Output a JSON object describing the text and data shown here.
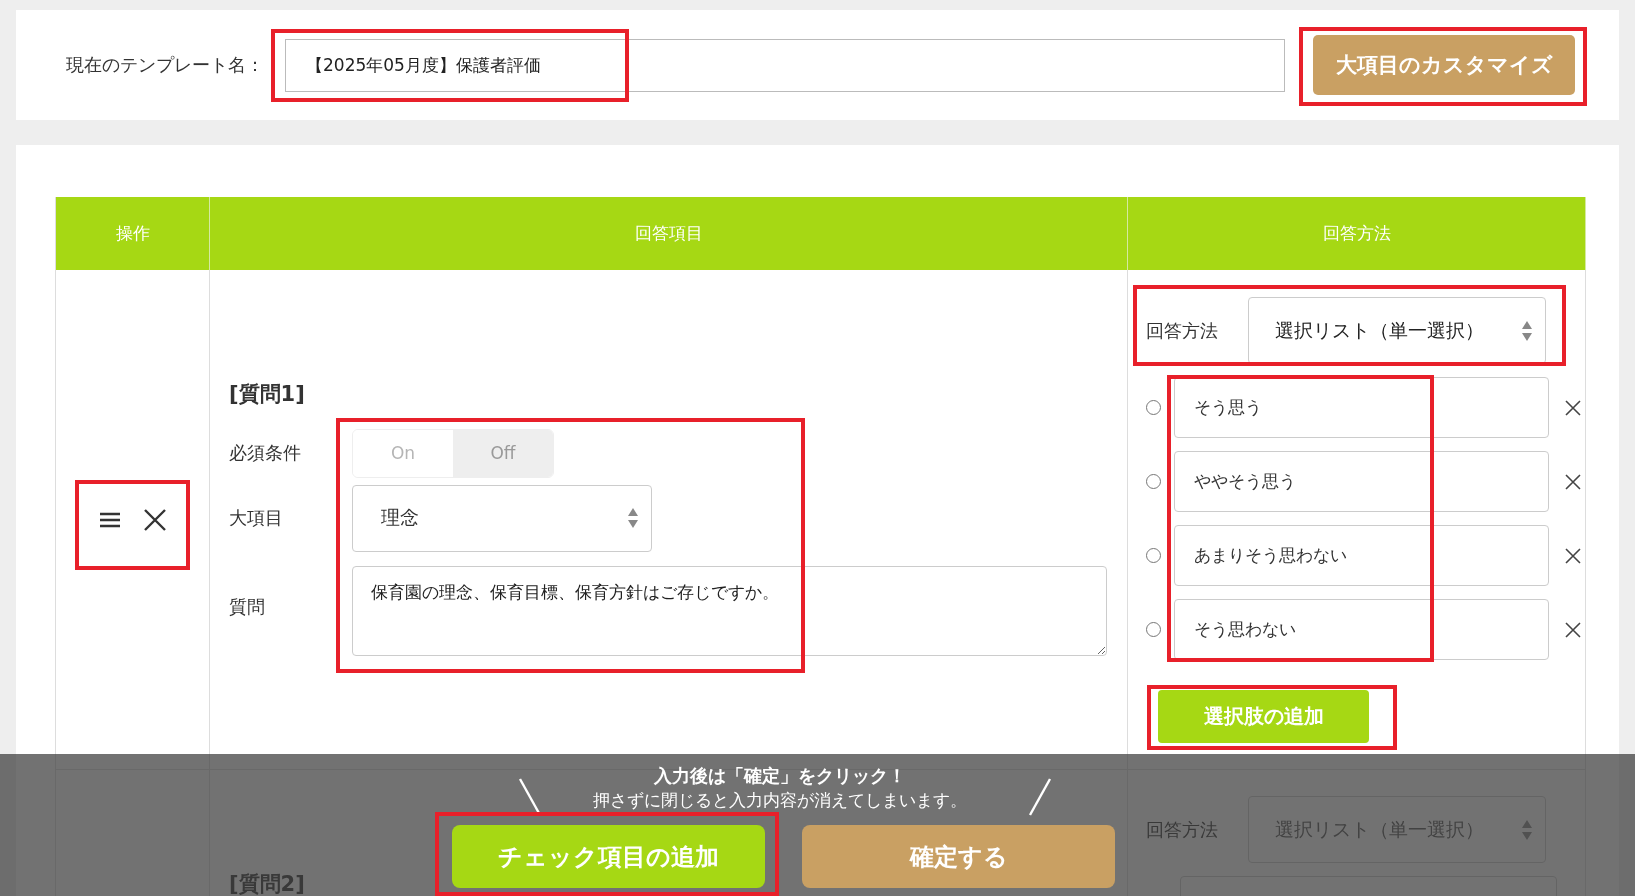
{
  "template": {
    "label": "現在のテンプレート名：",
    "value": "【2025年05月度】保護者評価",
    "customize_button": "大項目のカスタマイズ"
  },
  "table": {
    "columns": [
      "操作",
      "回答項目",
      "回答方法"
    ],
    "rows": [
      {
        "heading": "[質問1]",
        "required": {
          "label": "必須条件",
          "options": [
            {
              "label": "On",
              "selected": false
            },
            {
              "label": "Off",
              "selected": true
            }
          ]
        },
        "category": {
          "label": "大項目",
          "value": "理念"
        },
        "question": {
          "label": "質問",
          "value": "保育園の理念、保育目標、保育方針はご存じですか。"
        },
        "method": {
          "label": "回答方法",
          "value": "選択リスト（単一選択）"
        },
        "choices": [
          {
            "text": "そう思う",
            "selected": false
          },
          {
            "text": "ややそう思う",
            "selected": false
          },
          {
            "text": "あまりそう思わない",
            "selected": false
          },
          {
            "text": "そう思わない",
            "selected": false
          }
        ],
        "add_choice": "選択肢の追加"
      },
      {
        "heading": "[質問2]",
        "method": {
          "label": "回答方法",
          "value": "選択リスト（単一選択）"
        }
      }
    ]
  },
  "footer": {
    "notice": "入力後は「確定」をクリック！",
    "warning": "押さずに閉じると入力内容が消えてしまいます。",
    "buttons": [
      {
        "label": "チェック項目の追加",
        "kind": "add"
      },
      {
        "label": "確定する",
        "kind": "confirm"
      }
    ]
  }
}
